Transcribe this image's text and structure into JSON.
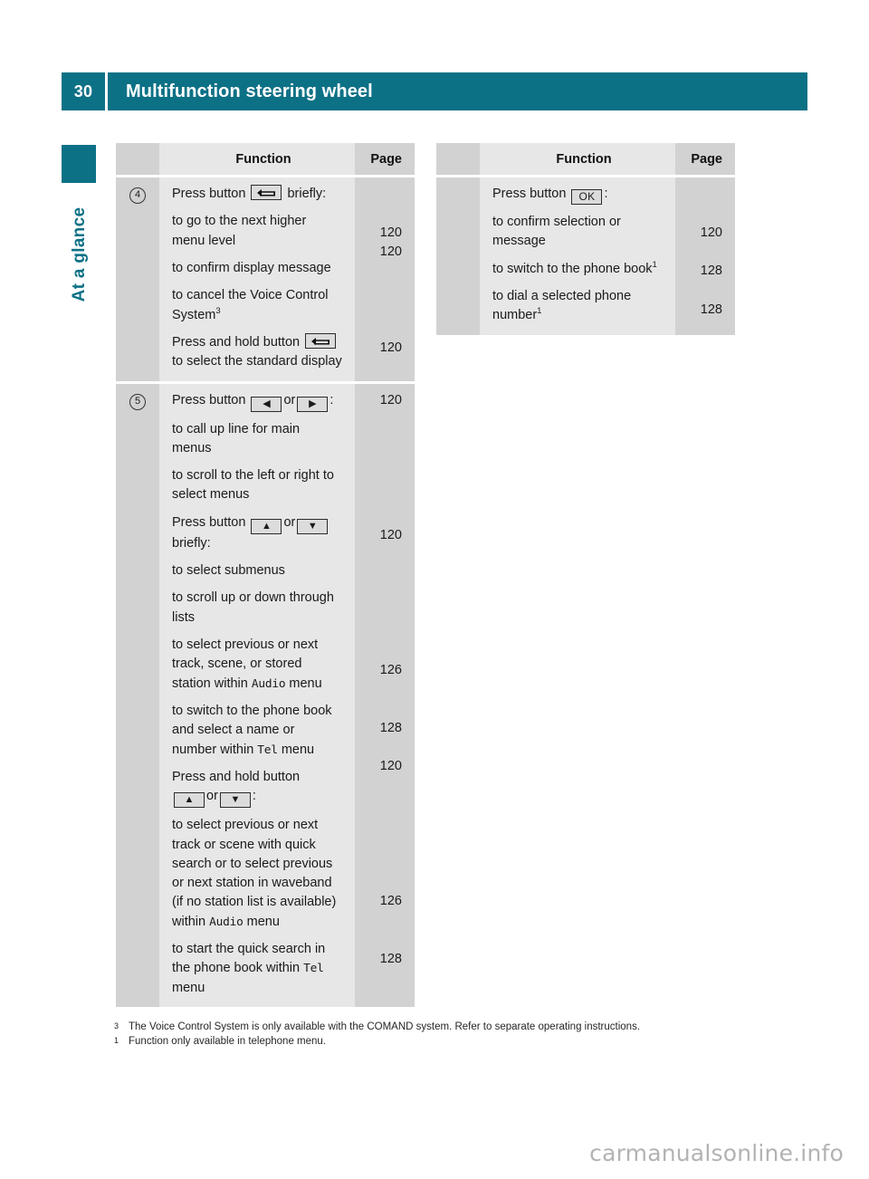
{
  "header": {
    "page_number": "30",
    "title": "Multifunction steering wheel",
    "accent_color": "#0d7186"
  },
  "side_tab": {
    "label": "At a glance"
  },
  "table_headers": {
    "function": "Function",
    "page": "Page"
  },
  "left_column": {
    "groups": [
      {
        "marker": "4",
        "blocks": [
          {
            "text_pre": "Press button ",
            "key": "back-arrow",
            "text_post": " briefly:",
            "page": ""
          },
          {
            "text": "to go to the next higher menu level",
            "page": "120"
          },
          {
            "text": "to confirm display message",
            "page": "120"
          },
          {
            "text": "to cancel the Voice Control System",
            "footnote": "3",
            "page": ""
          },
          {
            "text_pre": "Press and hold button ",
            "key": "back-arrow",
            "text_post": " to select the standard display",
            "page": "120"
          }
        ]
      },
      {
        "marker": "5",
        "blocks": [
          {
            "text_pre": "Press button ",
            "key": "left-right",
            "text_post": ":",
            "page": "120"
          },
          {
            "text": "to call up line for main menus",
            "page": ""
          },
          {
            "text": "to scroll to the left or right to select menus",
            "page": ""
          },
          {
            "text_pre": "Press button ",
            "key": "up-down",
            "text_post": " briefly:",
            "page": "120"
          },
          {
            "text": "to select submenus",
            "page": ""
          },
          {
            "text": "to scroll up or down through lists",
            "page": ""
          },
          {
            "text": "to select previous or next track, scene, or stored station within ",
            "mono": "Audio",
            "text_post": " menu",
            "page": "126"
          },
          {
            "text": "to switch to the phone book and select a name or number within ",
            "mono": "Tel",
            "text_post": " menu",
            "page": "128"
          },
          {
            "text_pre": "Press and hold button ",
            "key": "up-down",
            "text_post": ":",
            "page": "120"
          },
          {
            "text": "to select previous or next track or scene with quick search or to select previous or next station in waveband (if no station list is available) within ",
            "mono": "Audio",
            "text_post": " menu",
            "page": "126"
          },
          {
            "text": "to start the quick search in the phone book within ",
            "mono": "Tel",
            "text_post": " menu",
            "page": "128"
          }
        ]
      }
    ]
  },
  "right_column": {
    "groups": [
      {
        "marker": "",
        "blocks": [
          {
            "text_pre": "Press button ",
            "key": "ok",
            "text_post": ":",
            "page": ""
          },
          {
            "text": "to confirm selection or message",
            "page": "120"
          },
          {
            "text": "to switch to the phone book",
            "footnote": "1",
            "page": "128"
          },
          {
            "text": "to dial a selected phone number",
            "footnote": "1",
            "page": "128"
          }
        ]
      }
    ]
  },
  "keys": {
    "ok_label": "OK",
    "left_glyph": "◀",
    "right_glyph": "▶",
    "up_glyph": "▲",
    "down_glyph": "▼",
    "or_label": "or"
  },
  "footnotes": [
    {
      "num": "3",
      "text": "The Voice Control System is only available with the COMAND system. Refer to separate operating instructions."
    },
    {
      "num": "1",
      "text": "Function only available in telephone menu."
    }
  ],
  "watermark": "carmanualsonline.info"
}
